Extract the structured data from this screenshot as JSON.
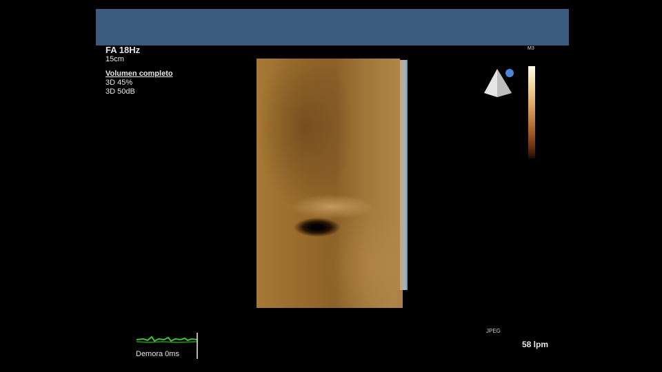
{
  "header": {
    "color": "#3a5a7e"
  },
  "info": {
    "freq": "FA 18Hz",
    "depth": "15cm",
    "mode": "Volumen completo",
    "line1": "3D 45%",
    "line2": "3D 50dB"
  },
  "colorbar": {
    "label": "M3"
  },
  "orientation": {
    "icon": "probe-orientation-icon",
    "marker_color": "#4a86d8"
  },
  "footer": {
    "format": "JPEG",
    "heart_rate": "58 lpm",
    "ecg_label": "Demora 0ms"
  }
}
